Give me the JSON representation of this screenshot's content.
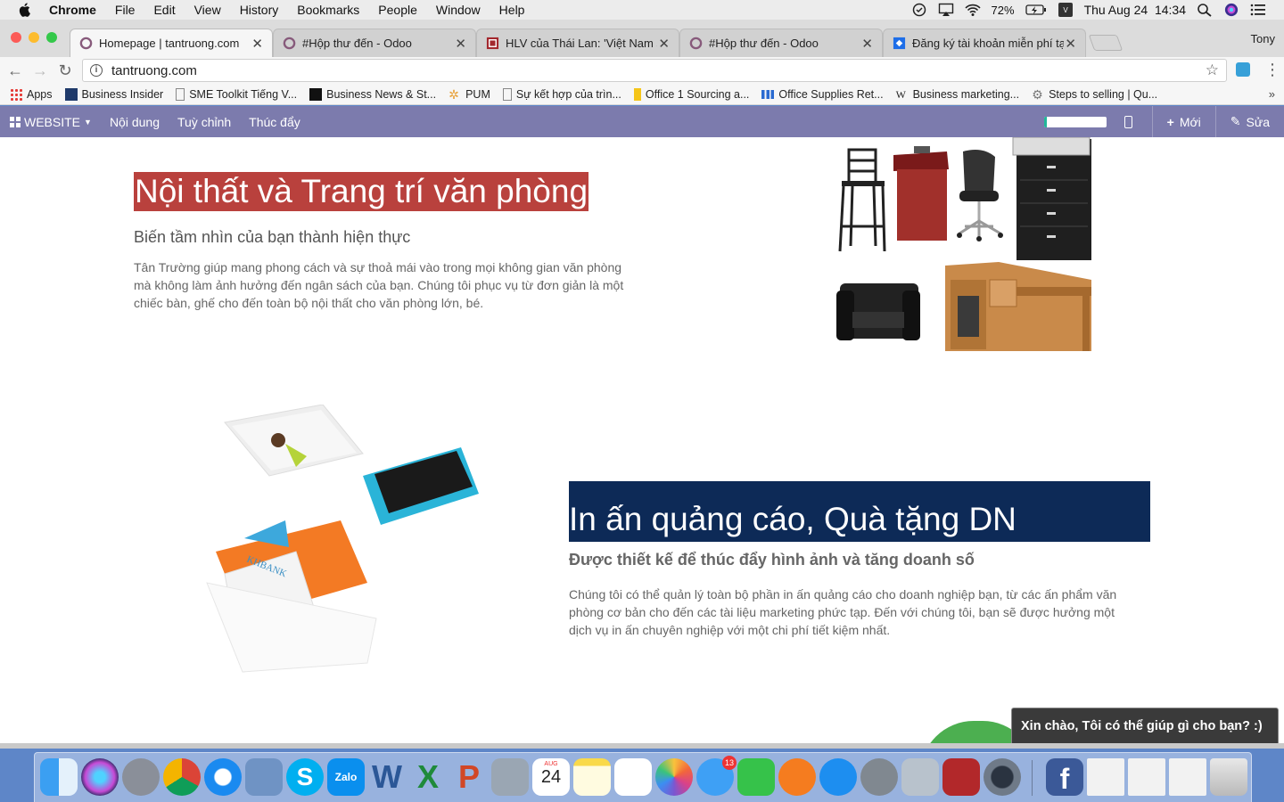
{
  "menubar": {
    "app": "Chrome",
    "items": [
      "File",
      "Edit",
      "View",
      "History",
      "Bookmarks",
      "People",
      "Window",
      "Help"
    ],
    "battery": "72%",
    "datetime": "Thu Aug 24  14:34"
  },
  "browser": {
    "profile": "Tony",
    "tabs": [
      {
        "title": "Homepage | tantruong.com",
        "active": true
      },
      {
        "title": "#Hộp thư đến - Odoo",
        "active": false
      },
      {
        "title": "HLV của Thái Lan: 'Việt Nam sẽ",
        "active": false
      },
      {
        "title": "#Hộp thư đến - Odoo",
        "active": false
      },
      {
        "title": "Đăng ký tài khoản miễn phí tại",
        "active": false
      }
    ],
    "url": "tantruong.com",
    "bookmarks": [
      "Apps",
      "Business Insider",
      "SME Toolkit Tiếng V...",
      "Business News & St...",
      "PUM",
      "Sự kết hợp của trìn...",
      "Office 1 Sourcing a...",
      "Office Supplies Ret...",
      "Business marketing...",
      "Steps to selling | Qu..."
    ]
  },
  "odoo_bar": {
    "website": "WEBSITE",
    "content": "Nội dung",
    "customize": "Tuỳ chỉnh",
    "promote": "Thúc đẩy",
    "new": "Mới",
    "edit": "Sửa"
  },
  "section1": {
    "title": "Nội thất và Trang trí văn phòng",
    "subtitle": "Biến tầm nhìn của bạn thành hiện thực",
    "body": "Tân Trường giúp mang phong cách và sự thoả mái vào trong mọi không gian văn phòng mà không làm ảnh hưởng đến ngân sách của bạn. Chúng tôi phục vụ từ đơn giản là một chiếc bàn, ghế cho đến toàn bộ nội thất cho văn phòng lớn, bé."
  },
  "section2": {
    "title": "In ấn quảng cáo, Quà tặng DN",
    "subtitle": "Được thiết kế để thúc đẩy hình ảnh và tăng doanh số",
    "body": "Chúng tôi có thể quản lý toàn bộ phần in ấn quảng cáo cho doanh nghiệp bạn, từ các ấn phẩm văn phòng cơ bản cho đến các tài liệu marketing phức tạp. Đến với chúng tôi, bạn sẽ được hưởng một dịch vụ in ấn chuyên nghiệp với một chi phí tiết kiệm nhất.",
    "card_brand": "KHBANK"
  },
  "chat": {
    "greeting": "Xin chào, Tôi có thể giúp gì cho bạn? :)"
  },
  "dock": {
    "calendar_month": "AUG",
    "calendar_day": "24",
    "messages_badge": "13",
    "zalo_label": "Zalo"
  }
}
